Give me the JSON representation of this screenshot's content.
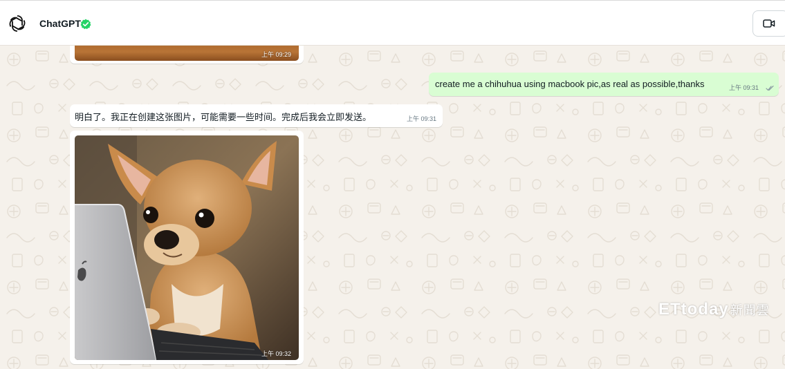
{
  "header": {
    "contact_name": "ChatGPT",
    "avatar_icon": "openai-logo-icon",
    "verified_icon": "verified-badge-icon",
    "verified_color": "#25d366",
    "call_icon": "video-call-icon"
  },
  "messages": [
    {
      "type": "image",
      "direction": "incoming",
      "time": "上午 09:29",
      "image_desc_icon": "photo-icon"
    },
    {
      "type": "text",
      "direction": "outgoing",
      "text": "create me a chihuhua using macbook pic,as real as possible,thanks",
      "time": "上午 09:31",
      "status_icon": "double-check-icon"
    },
    {
      "type": "text",
      "direction": "incoming",
      "text": "明白了。我正在创建这张图片，可能需要一些时间。完成后我会立即发送。",
      "time": "上午 09:31"
    },
    {
      "type": "image",
      "direction": "incoming",
      "time": "上午 09:32",
      "image_desc_icon": "photo-icon"
    }
  ],
  "watermark": {
    "latin": "ETtoday",
    "chinese": "新聞雲"
  },
  "colors": {
    "chat_bg": "#f5f1eb",
    "outgoing_bubble": "#d9fdd3",
    "incoming_bubble": "#ffffff"
  }
}
